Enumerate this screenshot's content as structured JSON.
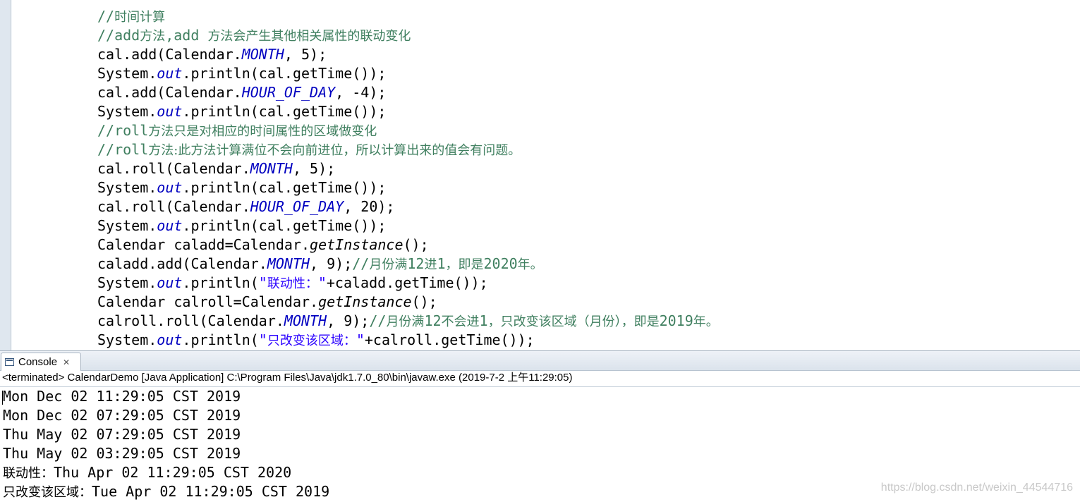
{
  "editor": {
    "lines": [
      {
        "indent": "",
        "parts": [
          {
            "t": "//",
            "c": "cm"
          },
          {
            "t": "时间计算",
            "c": "cmz"
          }
        ]
      },
      {
        "indent": "",
        "parts": [
          {
            "t": "//add",
            "c": "cm"
          },
          {
            "t": "方法",
            "c": "cmz"
          },
          {
            "t": ",add ",
            "c": "cm"
          },
          {
            "t": "方法会产生其他相关属性的联动变化",
            "c": "cmz"
          }
        ]
      },
      {
        "indent": "",
        "parts": [
          {
            "t": "cal.add(Calendar."
          },
          {
            "t": "MONTH",
            "c": "fld"
          },
          {
            "t": ", 5);"
          }
        ]
      },
      {
        "indent": "",
        "parts": [
          {
            "t": "System."
          },
          {
            "t": "out",
            "c": "fld"
          },
          {
            "t": ".println(cal.getTime());"
          }
        ]
      },
      {
        "indent": "",
        "parts": [
          {
            "t": "cal.add(Calendar."
          },
          {
            "t": "HOUR_OF_DAY",
            "c": "fld"
          },
          {
            "t": ", -4);"
          }
        ]
      },
      {
        "indent": "",
        "current": true,
        "parts": [
          {
            "t": "System."
          },
          {
            "t": "out",
            "c": "fld"
          },
          {
            "t": ".println(cal.getTime());"
          }
        ]
      },
      {
        "indent": "",
        "parts": [
          {
            "t": "//roll",
            "c": "cm"
          },
          {
            "t": "方法只是对相应的时间属性的区域做变化",
            "c": "cmz"
          }
        ]
      },
      {
        "indent": "",
        "parts": [
          {
            "t": "//roll",
            "c": "cm"
          },
          {
            "t": "方法:此方法计算满位不会向前进位，所以计算出来的值会有问题。",
            "c": "cmz"
          }
        ]
      },
      {
        "indent": "",
        "parts": [
          {
            "t": "cal.roll(Calendar."
          },
          {
            "t": "MONTH",
            "c": "fld"
          },
          {
            "t": ", 5);"
          }
        ]
      },
      {
        "indent": "",
        "parts": [
          {
            "t": "System."
          },
          {
            "t": "out",
            "c": "fld"
          },
          {
            "t": ".println(cal.getTime());"
          }
        ]
      },
      {
        "indent": "",
        "parts": [
          {
            "t": "cal.roll(Calendar."
          },
          {
            "t": "HOUR_OF_DAY",
            "c": "fld"
          },
          {
            "t": ", 20);"
          }
        ]
      },
      {
        "indent": "",
        "parts": [
          {
            "t": "System."
          },
          {
            "t": "out",
            "c": "fld"
          },
          {
            "t": ".println(cal.getTime());"
          }
        ]
      },
      {
        "indent": "",
        "parts": [
          {
            "t": "Calendar caladd=Calendar."
          },
          {
            "t": "getInstance",
            "c": "sfn"
          },
          {
            "t": "();"
          }
        ]
      },
      {
        "indent": "",
        "parts": [
          {
            "t": "caladd.add(Calendar."
          },
          {
            "t": "MONTH",
            "c": "fld"
          },
          {
            "t": ", 9);"
          },
          {
            "t": "//",
            "c": "cm"
          },
          {
            "t": "月份满",
            "c": "cmz"
          },
          {
            "t": "12",
            "c": "cm"
          },
          {
            "t": "进",
            "c": "cmz"
          },
          {
            "t": "1",
            "c": "cm"
          },
          {
            "t": "，即是",
            "c": "cmz"
          },
          {
            "t": "2020",
            "c": "cm"
          },
          {
            "t": "年。",
            "c": "cmz"
          }
        ]
      },
      {
        "indent": "",
        "parts": [
          {
            "t": "System."
          },
          {
            "t": "out",
            "c": "fld"
          },
          {
            "t": ".println("
          },
          {
            "t": "\"",
            "c": "str"
          },
          {
            "t": "联动性：",
            "c": "strz"
          },
          {
            "t": "\"",
            "c": "str"
          },
          {
            "t": "+caladd.getTime());"
          }
        ]
      },
      {
        "indent": "",
        "parts": [
          {
            "t": "Calendar calroll=Calendar."
          },
          {
            "t": "getInstance",
            "c": "sfn"
          },
          {
            "t": "();"
          }
        ]
      },
      {
        "indent": "",
        "parts": [
          {
            "t": "calroll.roll(Calendar."
          },
          {
            "t": "MONTH",
            "c": "fld"
          },
          {
            "t": ", 9);"
          },
          {
            "t": "//",
            "c": "cm"
          },
          {
            "t": "月份满",
            "c": "cmz"
          },
          {
            "t": "12",
            "c": "cm"
          },
          {
            "t": "不会进",
            "c": "cmz"
          },
          {
            "t": "1",
            "c": "cm"
          },
          {
            "t": "，只改变该区域（月份），即是",
            "c": "cmz"
          },
          {
            "t": "2019",
            "c": "cm"
          },
          {
            "t": "年。",
            "c": "cmz"
          }
        ]
      },
      {
        "indent": "",
        "parts": [
          {
            "t": "System."
          },
          {
            "t": "out",
            "c": "fld"
          },
          {
            "t": ".println("
          },
          {
            "t": "\"",
            "c": "str"
          },
          {
            "t": "只改变该区域：",
            "c": "strz"
          },
          {
            "t": "\"",
            "c": "str"
          },
          {
            "t": "+calroll.getTime());"
          }
        ]
      }
    ]
  },
  "console": {
    "tab_label": "Console",
    "tab_close": "✕",
    "status": "<terminated> CalendarDemo [Java Application] C:\\Program Files\\Java\\jdk1.7.0_80\\bin\\javaw.exe (2019-7-2 上午11:29:05)",
    "output": [
      {
        "prefix": "",
        "text": "Mon Dec 02 11:29:05 CST 2019"
      },
      {
        "prefix": "",
        "text": "Mon Dec 02 07:29:05 CST 2019"
      },
      {
        "prefix": "",
        "text": "Thu May 02 07:29:05 CST 2019"
      },
      {
        "prefix": "",
        "text": "Thu May 02 03:29:05 CST 2019"
      },
      {
        "prefix": "联动性：",
        "text": "Thu Apr 02 11:29:05 CST 2020"
      },
      {
        "prefix": "只改变该区域：",
        "text": "Tue Apr 02 11:29:05 CST 2019"
      }
    ]
  },
  "watermark": "https://blog.csdn.net/weixin_44544716",
  "colors": {
    "comment": "#3f7f5f",
    "field": "#0000c0",
    "string": "#2a00ff",
    "current_line": "#e8f2fe"
  }
}
